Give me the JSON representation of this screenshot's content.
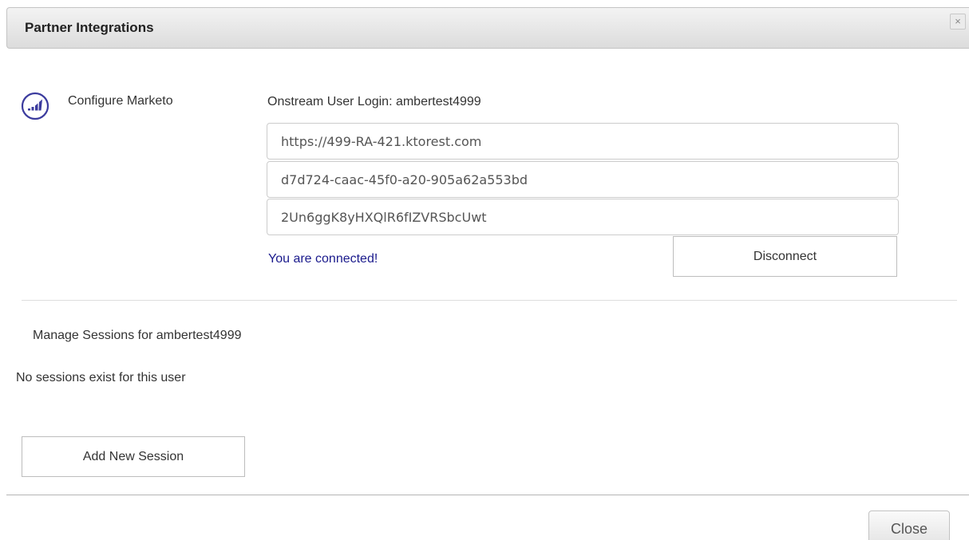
{
  "dialog": {
    "title": "Partner Integrations",
    "close_icon": "×"
  },
  "integration": {
    "icon": "marketo-icon",
    "configure_label": "Configure Marketo",
    "login_label": "Onstream User Login: ambertest4999",
    "fields": [
      {
        "value": "https://499-RA-421.ktorest.com"
      },
      {
        "value": "d7d724-caac-45f0-a20-905a62a553bd"
      },
      {
        "value": "2Un6ggK8yHXQlR6fIZVRSbcUwt"
      }
    ],
    "status_text": "You are connected!",
    "disconnect_label": "Disconnect",
    "accent_color": "#3b3b9e",
    "status_color": "#1a1a8c"
  },
  "sessions": {
    "heading": "Manage Sessions for ambertest4999",
    "empty_text": "No sessions exist for this user",
    "add_label": "Add New Session"
  },
  "footer": {
    "close_label": "Close"
  }
}
